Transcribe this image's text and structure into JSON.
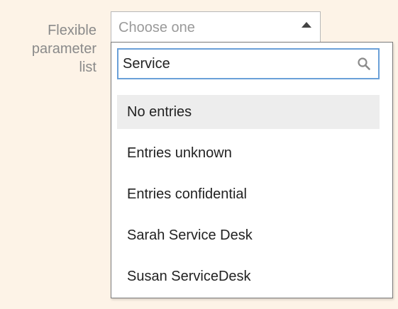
{
  "field": {
    "label_lines": [
      "Flexible",
      "parameter",
      "list"
    ]
  },
  "select": {
    "placeholder": "Choose one",
    "arrow_icon": "chevron-up-icon"
  },
  "dropdown": {
    "search_value": "Service",
    "search_icon": "search-icon",
    "options": [
      {
        "label": "No entries",
        "highlighted": true
      },
      {
        "label": "Entries unknown",
        "highlighted": false
      },
      {
        "label": "Entries confidential",
        "highlighted": false
      },
      {
        "label": "Sarah Service Desk",
        "highlighted": false
      },
      {
        "label": "Susan ServiceDesk",
        "highlighted": false
      }
    ]
  },
  "colors": {
    "page_background": "#fdf3e7",
    "focus_border": "#6aa0d8",
    "highlight": "#ededed"
  }
}
